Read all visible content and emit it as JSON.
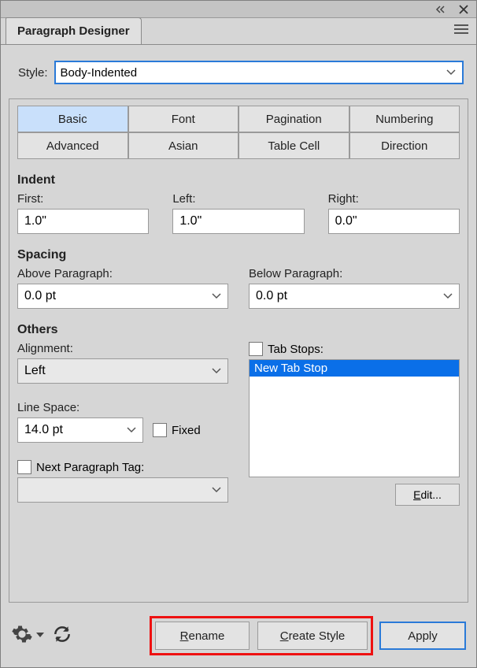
{
  "panel": {
    "title": "Paragraph Designer"
  },
  "style": {
    "label": "Style:",
    "value": "Body-Indented"
  },
  "tabs": {
    "row1": [
      "Basic",
      "Font",
      "Pagination",
      "Numbering"
    ],
    "row2": [
      "Advanced",
      "Asian",
      "Table Cell",
      "Direction"
    ],
    "active": "Basic"
  },
  "indent": {
    "heading": "Indent",
    "first_label": "First:",
    "first_value": "1.0\"",
    "left_label": "Left:",
    "left_value": "1.0\"",
    "right_label": "Right:",
    "right_value": "0.0\""
  },
  "spacing": {
    "heading": "Spacing",
    "above_label": "Above Paragraph:",
    "above_value": "0.0 pt",
    "below_label": "Below Paragraph:",
    "below_value": "0.0 pt"
  },
  "others": {
    "heading": "Others",
    "alignment_label": "Alignment:",
    "alignment_value": "Left",
    "line_space_label": "Line Space:",
    "line_space_value": "14.0 pt",
    "fixed_label": "Fixed",
    "tab_stops_label": "Tab Stops:",
    "tab_stops_item": "New Tab Stop",
    "next_para_label": "Next Paragraph Tag:",
    "next_para_value": "",
    "edit_label": "Edit..."
  },
  "footer": {
    "rename": "Rename",
    "create": "Create Style",
    "apply": "Apply"
  }
}
